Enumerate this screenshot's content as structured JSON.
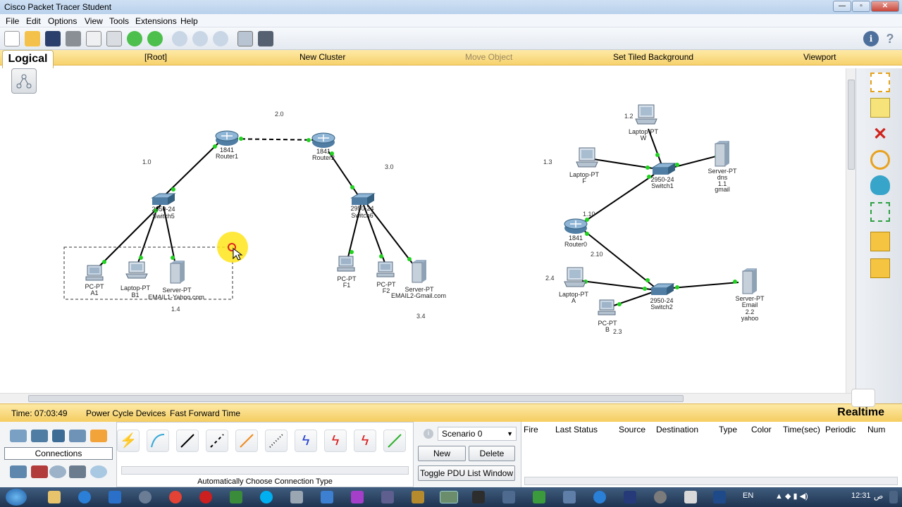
{
  "window": {
    "title": "Cisco Packet Tracer Student"
  },
  "menu": [
    "File",
    "Edit",
    "Options",
    "View",
    "Tools",
    "Extensions",
    "Help"
  ],
  "navbar": {
    "tab": "Logical",
    "root": "[Root]",
    "new_cluster": "New Cluster",
    "move_object": "Move Object",
    "set_tiled": "Set Tiled Background",
    "viewport": "Viewport"
  },
  "topology": {
    "networks": [
      {
        "id": "n20",
        "text": "2.0"
      },
      {
        "id": "n10",
        "text": "1.0"
      },
      {
        "id": "n30",
        "text": "3.0"
      },
      {
        "id": "n14",
        "text": "1.4"
      },
      {
        "id": "n34",
        "text": "3.4"
      },
      {
        "id": "n12",
        "text": "1.2"
      },
      {
        "id": "n13",
        "text": "1.3"
      },
      {
        "id": "n110",
        "text": "1.10"
      },
      {
        "id": "n210",
        "text": "2.10"
      },
      {
        "id": "n24",
        "text": "2.4"
      },
      {
        "id": "n23",
        "text": "2.3"
      }
    ],
    "devices": [
      {
        "id": "router1",
        "model": "1841",
        "name": "Router1"
      },
      {
        "id": "router2",
        "model": "1841",
        "name": "Router2"
      },
      {
        "id": "switch5",
        "model": "2950-24",
        "name": "Switch5"
      },
      {
        "id": "switch6",
        "model": "2950-24",
        "name": "Switch6"
      },
      {
        "id": "pca1",
        "model": "PC-PT",
        "name": "A1"
      },
      {
        "id": "lapb1",
        "model": "Laptop-PT",
        "name": "B1"
      },
      {
        "id": "srv_yahoo",
        "model": "Server-PT",
        "name": "EMAIL1-Yahoo.com"
      },
      {
        "id": "pcf1",
        "model": "PC-PT",
        "name": "F1"
      },
      {
        "id": "pcf2",
        "model": "PC-PT",
        "name": "F2"
      },
      {
        "id": "srv_gmail",
        "model": "Server-PT",
        "name": "EMAIL2-Gmail.com"
      },
      {
        "id": "lapw",
        "model": "Laptop-PT",
        "name": "W"
      },
      {
        "id": "lapf",
        "model": "Laptop-PT",
        "name": "F"
      },
      {
        "id": "switch1",
        "model": "2950-24",
        "name": "Switch1"
      },
      {
        "id": "srv_dns",
        "model": "Server-PT",
        "name": "dns",
        "extra1": "1.1",
        "extra2": "gmail"
      },
      {
        "id": "router0",
        "model": "1841",
        "name": "Router0"
      },
      {
        "id": "lapa",
        "model": "Laptop-PT",
        "name": "A"
      },
      {
        "id": "pcb",
        "model": "PC-PT",
        "name": "B"
      },
      {
        "id": "switch2",
        "model": "2950-24",
        "name": "Switch2"
      },
      {
        "id": "srv_email",
        "model": "Server-PT",
        "name": "Email",
        "extra1": "2.2",
        "extra2": "yahoo"
      }
    ]
  },
  "status": {
    "time": "Time: 07:03:49",
    "power_cycle": "Power Cycle Devices",
    "fast_forward": "Fast Forward Time",
    "mode": "Realtime"
  },
  "bottom": {
    "connections_label": "Connections",
    "auto_connection": "Automatically Choose Connection Type",
    "scenario": "Scenario 0",
    "new_btn": "New",
    "delete_btn": "Delete",
    "toggle_btn": "Toggle PDU List Window",
    "pdu_columns": [
      "Fire",
      "Last Status",
      "Source",
      "Destination",
      "Type",
      "Color",
      "Time(sec)",
      "Periodic",
      "Num"
    ]
  },
  "taskbar": {
    "lang": "EN",
    "clock": "12:31",
    "ampm": "ص"
  },
  "colors": {
    "link_up": "#1fd31f",
    "navbar": "#f7d26d",
    "accent": "#4d6f9c"
  }
}
